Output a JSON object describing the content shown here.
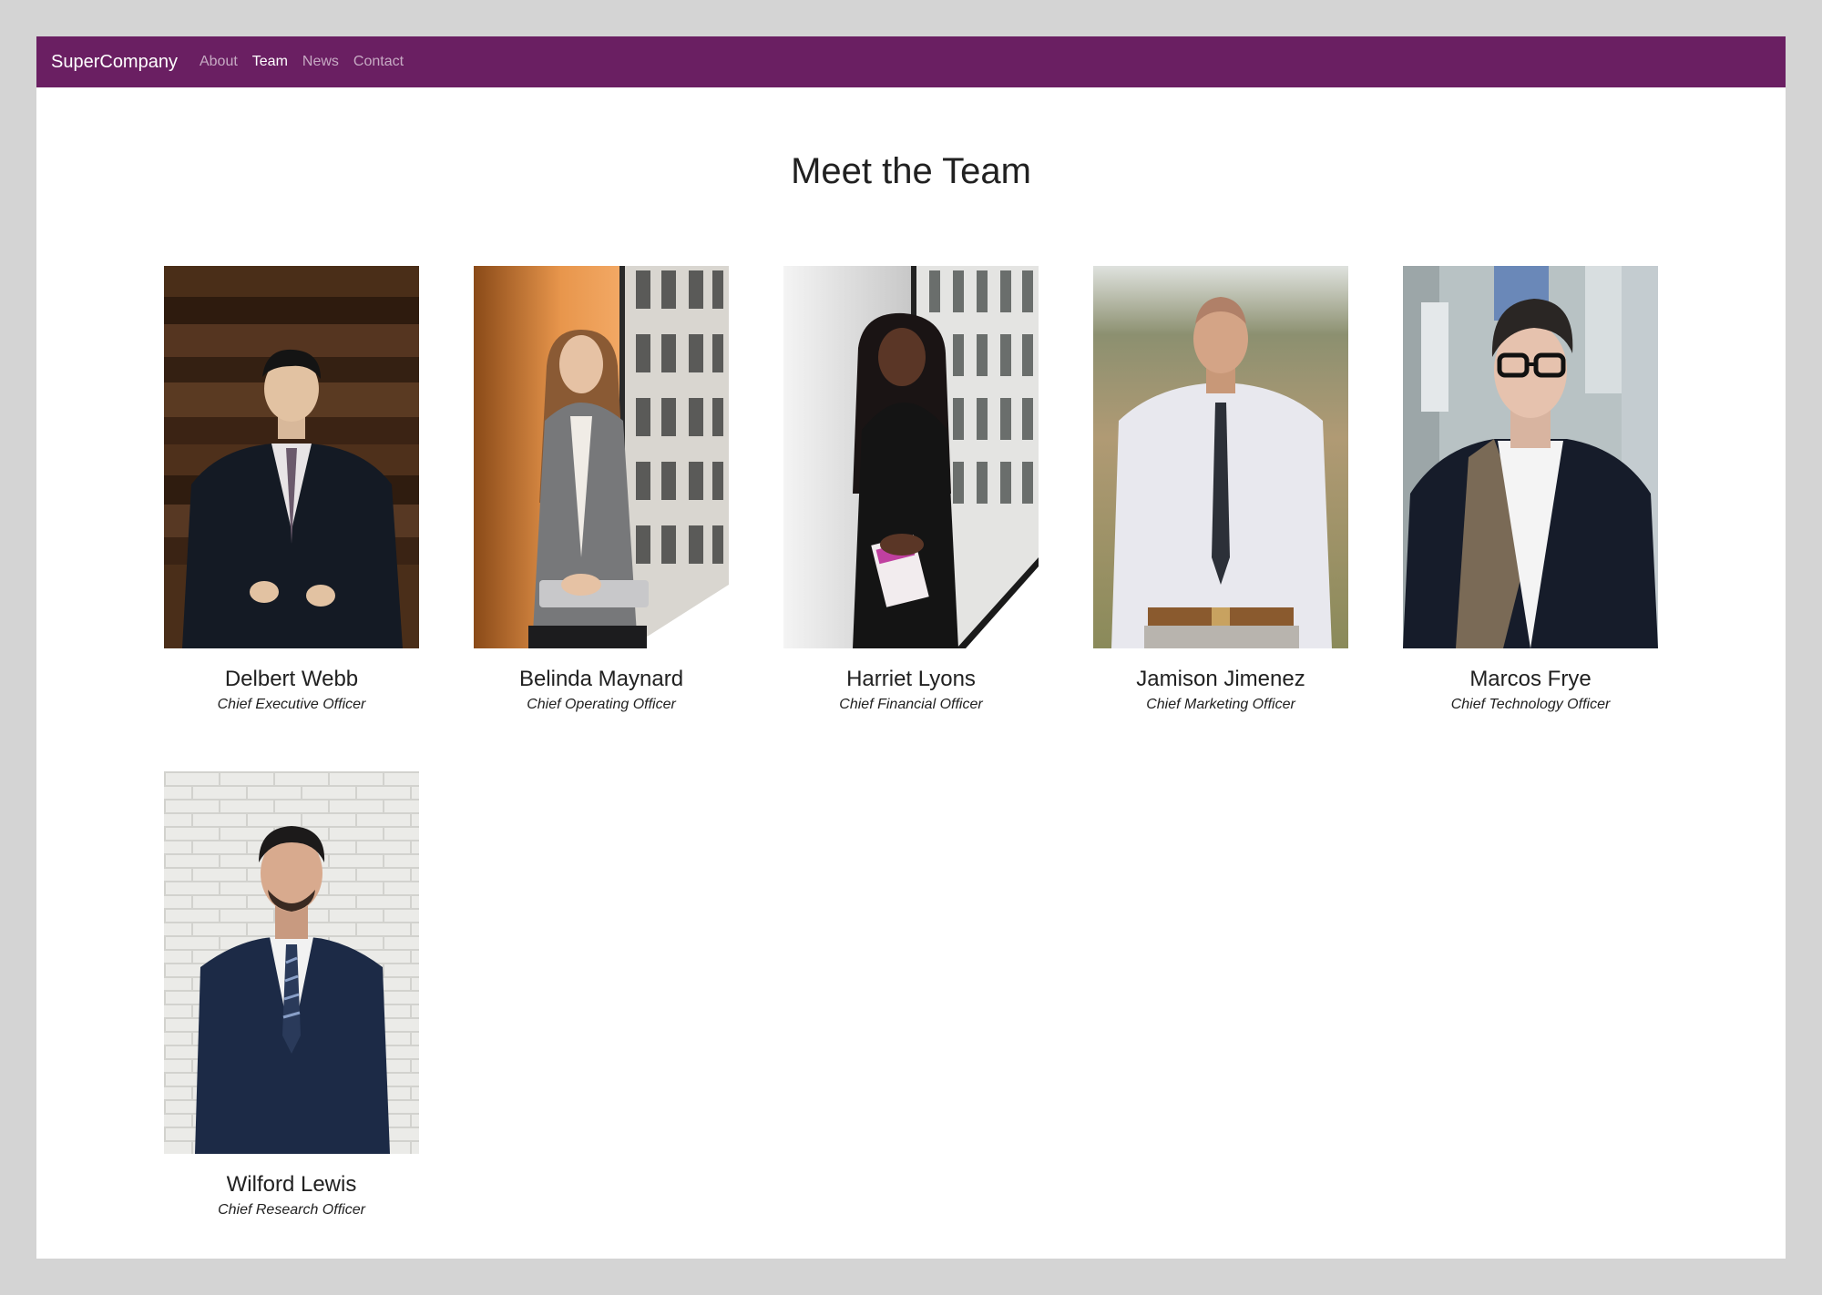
{
  "navbar": {
    "brand": "SuperCompany",
    "links": [
      {
        "label": "About",
        "active": false
      },
      {
        "label": "Team",
        "active": true
      },
      {
        "label": "News",
        "active": false
      },
      {
        "label": "Contact",
        "active": false
      }
    ],
    "color": "#6a1f62"
  },
  "page": {
    "title": "Meet the Team"
  },
  "team": [
    {
      "name": "Delbert Webb",
      "role": "Chief Executive Officer"
    },
    {
      "name": "Belinda Maynard",
      "role": "Chief Operating Officer"
    },
    {
      "name": "Harriet Lyons",
      "role": "Chief Financial Officer"
    },
    {
      "name": "Jamison Jimenez",
      "role": "Chief Marketing Officer"
    },
    {
      "name": "Marcos Frye",
      "role": "Chief Technology Officer"
    },
    {
      "name": "Wilford Lewis",
      "role": "Chief Research Officer"
    }
  ]
}
